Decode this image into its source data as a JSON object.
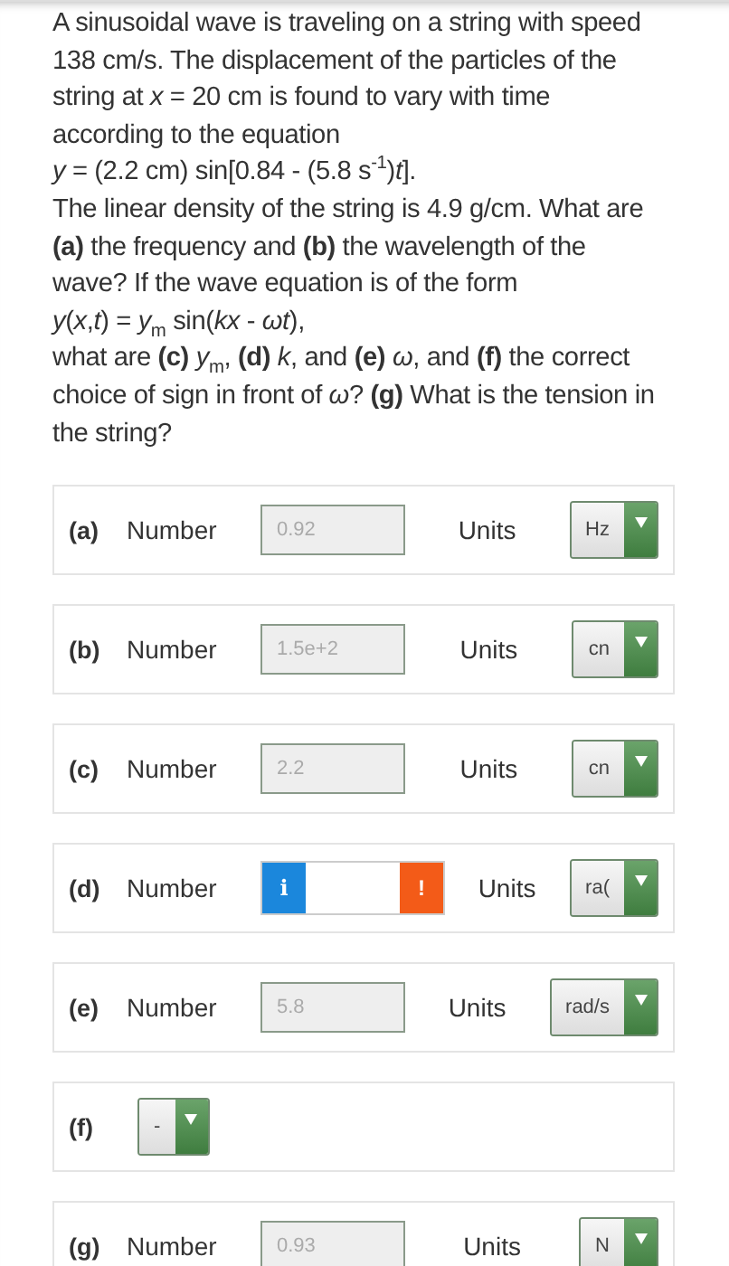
{
  "question": [
    "A sinusoidal wave is traveling on a string with speed 138 cm/s. The displacement of the particles of the string at *x* = 20 cm is found to vary with time according to the equation",
    "*y* = (2.2 cm) sin[0.84 - (5.8 s$^{-1}$)*t*].",
    "The linear density of the string is 4.9 g/cm. What are **(a)** the frequency and **(b)** the wavelength of the wave? If the wave equation is of the form",
    "*y*(*x*,*t*) = *y*$_{m}$ sin(*kx* - *ωt*),",
    "what are **(c)** *y*$_{m}$, **(d)** *k*, and **(e)** *ω*, and **(f)** the correct choice of sign in front of *ω*? **(g)** What is the tension in the string?"
  ],
  "parts": [
    {
      "kind": "number",
      "label": "(a)",
      "field_label": "Number",
      "value": "0.92",
      "units_label": "Units",
      "unit": "Hz"
    },
    {
      "kind": "number",
      "label": "(b)",
      "field_label": "Number",
      "value": "1.5e+2",
      "units_label": "Units",
      "unit": "cn"
    },
    {
      "kind": "number",
      "label": "(c)",
      "field_label": "Number",
      "value": "2.2",
      "units_label": "Units",
      "unit": "cn"
    },
    {
      "kind": "feedback",
      "label": "(d)",
      "field_label": "Number",
      "info": "i",
      "warning": "!",
      "units_label": "Units",
      "unit": "ra("
    },
    {
      "kind": "number",
      "label": "(e)",
      "field_label": "Number",
      "value": "5.8",
      "units_label": "Units",
      "unit": "rad/s"
    },
    {
      "kind": "sign",
      "label": "(f)",
      "unit": "-"
    },
    {
      "kind": "number",
      "label": "(g)",
      "field_label": "Number",
      "value": "0.93",
      "units_label": "Units",
      "unit": "N"
    }
  ]
}
